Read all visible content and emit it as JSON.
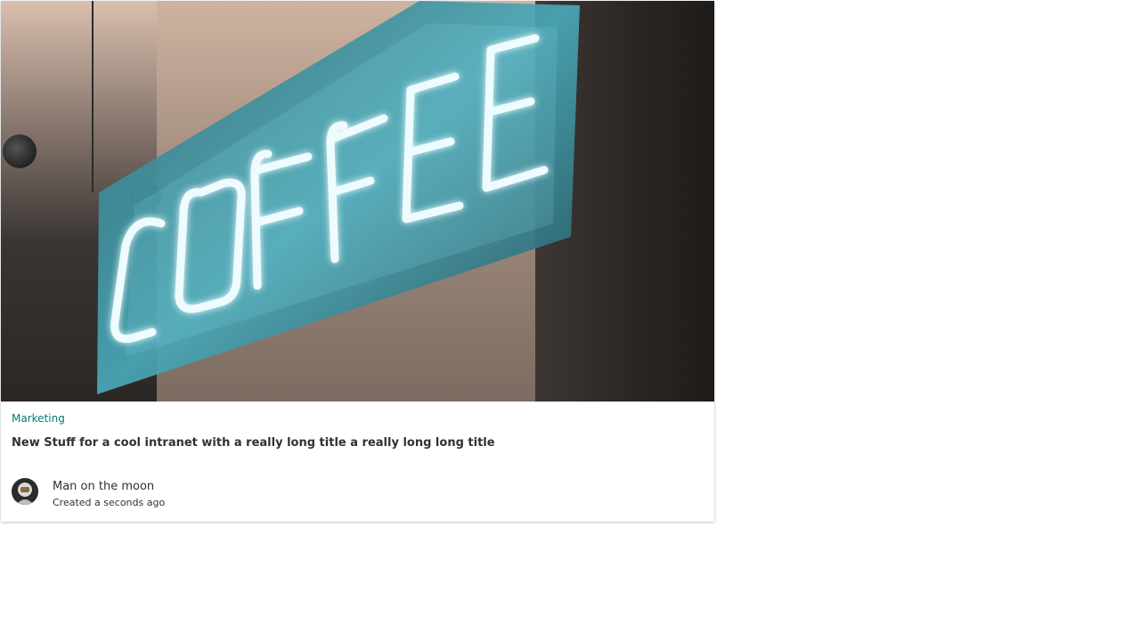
{
  "card": {
    "image_alt": "COFFEE",
    "category": "Marketing",
    "title": "New Stuff for a cool intranet with a really long title a really long long title",
    "author": {
      "name": "Man on the moon",
      "meta": "Created a seconds ago"
    }
  },
  "colors": {
    "category": "#03787c",
    "text": "#323130",
    "neon": "#e9fbff",
    "neon_glow": "#5fd3e6"
  },
  "icons": {
    "avatar": "person-avatar-icon"
  }
}
